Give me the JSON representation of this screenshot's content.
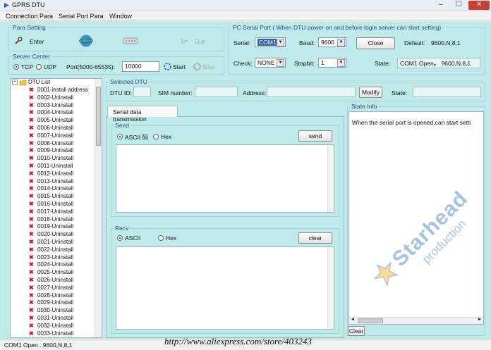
{
  "window": {
    "title": "GPRS DTU",
    "minimize": "–",
    "maximize": "☐",
    "close": "✕"
  },
  "menu": [
    "Connection Para",
    "Serial Port Para",
    "Window"
  ],
  "para_setting": {
    "title": "Para Setting",
    "enter": "Enter",
    "out": "Out"
  },
  "server_center": {
    "title": "Server Center",
    "tcp": "TCP",
    "udp": "UDP",
    "port_label": "Port(5000-65535):",
    "port_value": "10000",
    "start": "Start",
    "stop": "Stop"
  },
  "pc_serial": {
    "title": "PC Serial Port ( When DTU power on and before login server can start setting)",
    "serial_label": "Serial:",
    "serial_value": "COM1",
    "baud_label": "Baud:",
    "baud_value": "9600",
    "close": "Close",
    "default_label": "Default:",
    "default_value": "9600,N,8,1",
    "check_label": "Check:",
    "check_value": "NONE",
    "stopbit_label": "Stopbit:",
    "stopbit_value": "1",
    "state_label": "State:",
    "state_value": "COM1 Open。 9600,N,8,1"
  },
  "dtu_list": {
    "title": "DTU List",
    "items": [
      "0001-install address",
      "0002-Uninstall",
      "0003-Uninstall",
      "0004-Uninstall",
      "0005-Uninstall",
      "0006-Uninstall",
      "0007-Uninstall",
      "0008-Uninstall",
      "0009-Uninstall",
      "0010-Uninstall",
      "0011-Uninstall",
      "0012-Uninstall",
      "0013-Uninstall",
      "0014-Uninstall",
      "0015-Uninstall",
      "0016-Uninstall",
      "0017-Uninstall",
      "0018-Uninstall",
      "0019-Uninstall",
      "0020-Uninstall",
      "0021-Uninstall",
      "0022-Uninstall",
      "0023-Uninstall",
      "0024-Uninstall",
      "0025-Uninstall",
      "0026-Uninstall",
      "0027-Uninstall",
      "0028-Uninstall",
      "0029-Uninstall",
      "0030-Uninstall",
      "0031-Uninstall",
      "0032-Uninstall",
      "0033-Uninstall"
    ]
  },
  "selected_dtu": {
    "title": "Selected DTU",
    "dtu_id_label": "DTU ID:",
    "dtu_id_value": "",
    "sim_label": "SIM number:",
    "sim_value": "",
    "address_label": "Address:",
    "address_value": "",
    "modify": "Modify",
    "state_label": "State:",
    "state_value": ""
  },
  "tab": {
    "label": "Serial data  transmission"
  },
  "send": {
    "title": "Send",
    "ascii": "ASCII 码",
    "hex": "Hex",
    "button": "send",
    "content": ""
  },
  "recv": {
    "title": "Recv",
    "ascii": "ASCII",
    "hex": "Hex",
    "button": "clear",
    "content": ""
  },
  "state_info": {
    "title": "State Info",
    "text": "When the serial port is opened,can start setti",
    "clear": "Clear"
  },
  "status_bar": "COM1 Open . 9600,N,8,1",
  "overlay": {
    "url": "http://www.aliexpress.com/store/403243",
    "brand": "Starhead",
    "brand_sub": "production"
  }
}
